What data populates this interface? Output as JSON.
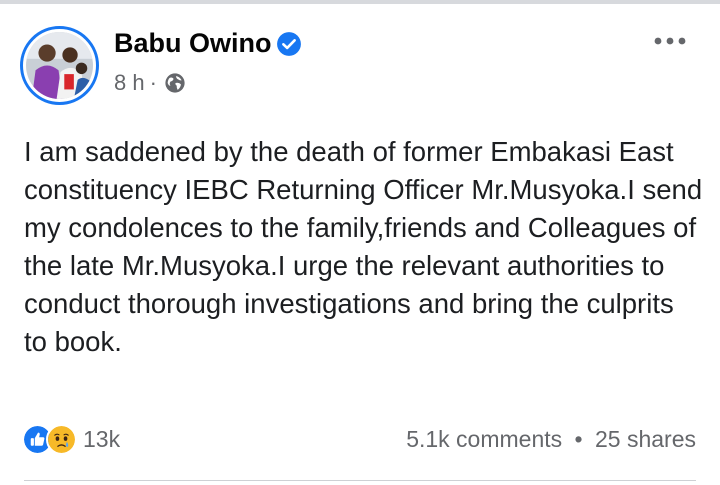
{
  "post": {
    "author": "Babu Owino",
    "time": "8 h",
    "separator": "·",
    "text": "I am saddened by the death of former Embakasi East constituency IEBC Returning Officer Mr.Musyoka.I send my condolences to the family,friends and Colleagues of the late Mr.Musyoka.I urge the relevant authorities to conduct thorough investigations and bring the culprits to book."
  },
  "footer": {
    "reaction_count": "13k",
    "comments": "5.1k comments",
    "bullet": "•",
    "shares": "25 shares"
  },
  "icons": {
    "verified": "verified-badge-icon",
    "audience": "globe-icon",
    "more": "more-options-icon",
    "reactions": [
      "like-reaction-icon",
      "sad-reaction-icon"
    ]
  },
  "colors": {
    "brand_blue": "#1877f2",
    "secondary_text": "#65676b",
    "sad_yellow": "#f7b928"
  }
}
